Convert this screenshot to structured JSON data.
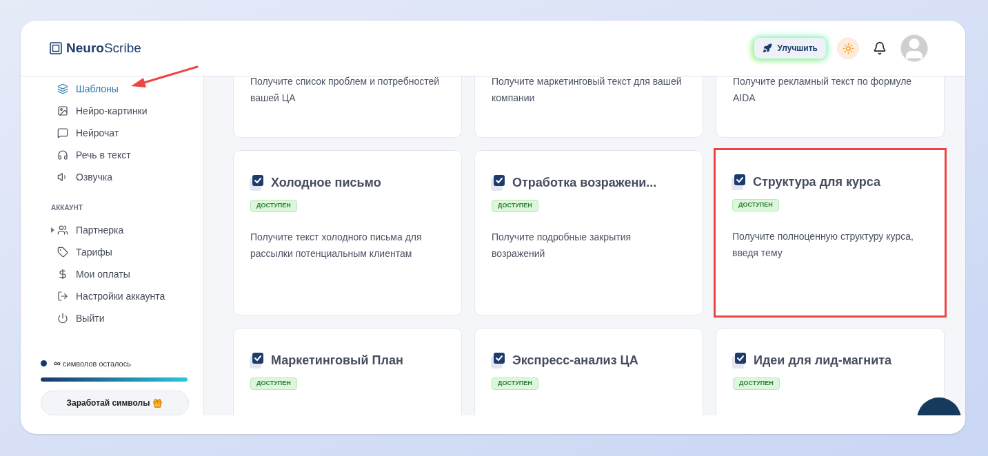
{
  "header": {
    "logo_bold": "Neuro",
    "logo_light": "Scribe",
    "upgrade_button": "Улучшить"
  },
  "sidebar": {
    "items": [
      {
        "label": "Шаблоны",
        "selected": true
      },
      {
        "label": "Нейро-картинки",
        "selected": false
      },
      {
        "label": "Нейрочат",
        "selected": false
      },
      {
        "label": "Речь в текст",
        "selected": false
      },
      {
        "label": "Озвучка",
        "selected": false
      }
    ],
    "section_title": "АККАУНТ",
    "account_items": [
      {
        "label": "Партнерка",
        "expandable": true
      },
      {
        "label": "Тарифы",
        "expandable": false
      },
      {
        "label": "Мои оплаты",
        "expandable": false
      },
      {
        "label": "Настройки аккаунта",
        "expandable": false
      },
      {
        "label": "Выйти",
        "expandable": false
      }
    ],
    "credits": {
      "amount": "∞",
      "label": "символов осталось",
      "level": 1
    },
    "earn_button": "Заработай символы"
  },
  "cards_top": [
    {
      "description": "Получите список проблем и потребностей вашей ЦА"
    },
    {
      "description": "Получите маркетинговый текст для вашей компании"
    },
    {
      "description": "Получите рекламный текст по формуле AIDA"
    }
  ],
  "cards": [
    {
      "title": "Холодное письмо",
      "badge": "ДОСТУПЕН",
      "description": "Получите текст холодного письма для рассылки потенциальным клиентам",
      "highlighted": false
    },
    {
      "title": "Отработка возражени...",
      "badge": "ДОСТУПЕН",
      "description": "Получите подробные закрытия возражений",
      "highlighted": false
    },
    {
      "title": "Структура для курса",
      "badge": "ДОСТУПЕН",
      "description": "Получите полноценную структуру курса, введя тему",
      "highlighted": true
    },
    {
      "title": "Маркетинговый План",
      "badge": "ДОСТУПЕН",
      "highlighted": false
    },
    {
      "title": "Экспресс-анализ ЦА",
      "badge": "ДОСТУПЕН",
      "highlighted": false
    },
    {
      "title": "Идеи для лид-магнита",
      "badge": "ДОСТУПЕН",
      "highlighted": false
    }
  ]
}
